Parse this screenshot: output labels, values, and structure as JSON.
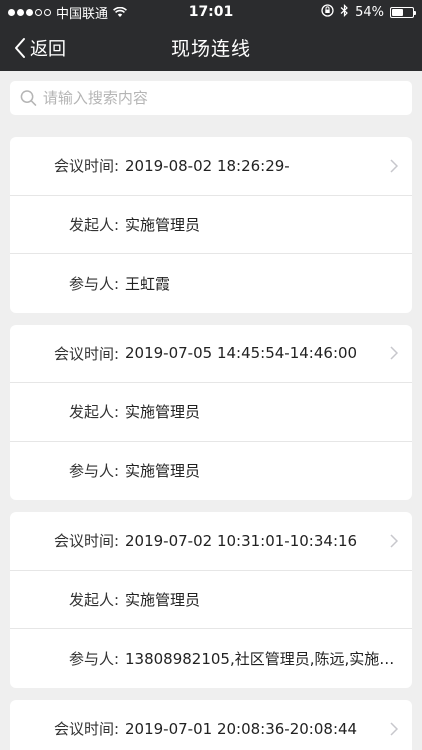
{
  "status_bar": {
    "carrier": "中国联通",
    "time": "17:01",
    "battery_percent": "54%",
    "battery_level": 0.54
  },
  "header": {
    "back_label": "返回",
    "title": "现场连线"
  },
  "search": {
    "placeholder": "请输入搜索内容"
  },
  "meetings": [
    {
      "time_label": "会议时间:",
      "time": "2019-08-02 18:26:29-",
      "initiator_label": "发起人:",
      "initiator": "实施管理员",
      "participants_label": "参与人:",
      "participants": "王虹霞"
    },
    {
      "time_label": "会议时间:",
      "time": "2019-07-05 14:45:54-14:46:00",
      "initiator_label": "发起人:",
      "initiator": "实施管理员",
      "participants_label": "参与人:",
      "participants": "实施管理员"
    },
    {
      "time_label": "会议时间:",
      "time": "2019-07-02 10:31:01-10:34:16",
      "initiator_label": "发起人:",
      "initiator": "实施管理员",
      "participants_label": "参与人:",
      "participants": "13808982105,社区管理员,陈远,实施…"
    },
    {
      "time_label": "会议时间:",
      "time": "2019-07-01 20:08:36-20:08:44"
    }
  ]
}
